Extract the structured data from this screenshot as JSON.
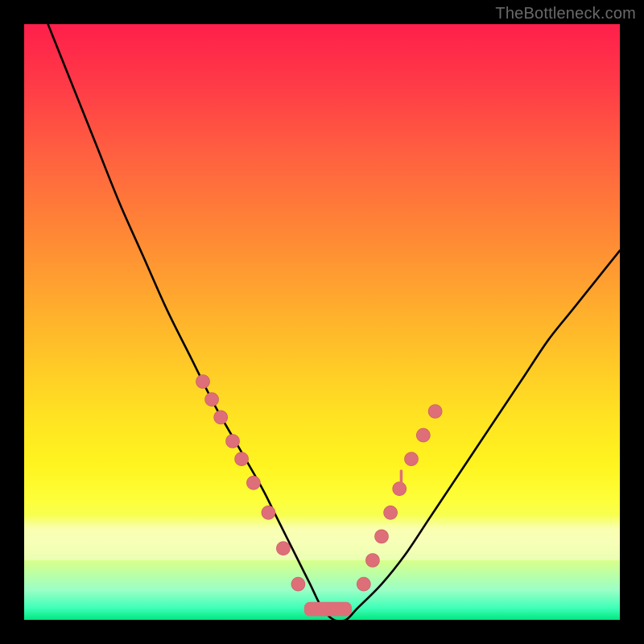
{
  "watermark": "TheBottleneck.com",
  "colors": {
    "curve": "#000000",
    "marker_fill": "#de6e78",
    "marker_stroke": "#c45762",
    "plateau": "#de6e78",
    "gradient_top": "#ff1f4b",
    "gradient_bottom": "#00e77f"
  },
  "chart_data": {
    "type": "line",
    "title": "",
    "xlabel": "",
    "ylabel": "",
    "xlim": [
      0,
      100
    ],
    "ylim": [
      0,
      100
    ],
    "grid": false,
    "series": [
      {
        "name": "bottleneck_curve",
        "x": [
          4,
          8,
          12,
          16,
          20,
          24,
          28,
          32,
          36,
          40,
          42,
          44,
          46,
          48,
          50,
          52,
          54,
          56,
          60,
          64,
          68,
          72,
          76,
          80,
          84,
          88,
          92,
          96,
          100
        ],
        "y": [
          100,
          90,
          80,
          70,
          61,
          52,
          44,
          36,
          29,
          22,
          18,
          14,
          10,
          6,
          2,
          0,
          0,
          2,
          6,
          11,
          17,
          23,
          29,
          35,
          41,
          47,
          52,
          57,
          62
        ]
      }
    ],
    "plateau": {
      "x_start": 47,
      "x_end": 55,
      "y": 1.8,
      "thickness": 2.4
    },
    "markers": {
      "left": [
        {
          "x": 30,
          "y": 40
        },
        {
          "x": 31.5,
          "y": 37
        },
        {
          "x": 33,
          "y": 34
        },
        {
          "x": 35,
          "y": 30
        },
        {
          "x": 36.5,
          "y": 27
        },
        {
          "x": 38.5,
          "y": 23
        },
        {
          "x": 41,
          "y": 18
        },
        {
          "x": 43.5,
          "y": 12
        },
        {
          "x": 46,
          "y": 6
        }
      ],
      "right": [
        {
          "x": 57,
          "y": 6
        },
        {
          "x": 58.5,
          "y": 10
        },
        {
          "x": 60,
          "y": 14
        },
        {
          "x": 61.5,
          "y": 18
        },
        {
          "x": 63,
          "y": 22
        },
        {
          "x": 65,
          "y": 27
        },
        {
          "x": 67,
          "y": 31
        },
        {
          "x": 69,
          "y": 35
        }
      ],
      "tick": [
        {
          "x": 63.3,
          "y": 23.5
        }
      ]
    }
  }
}
